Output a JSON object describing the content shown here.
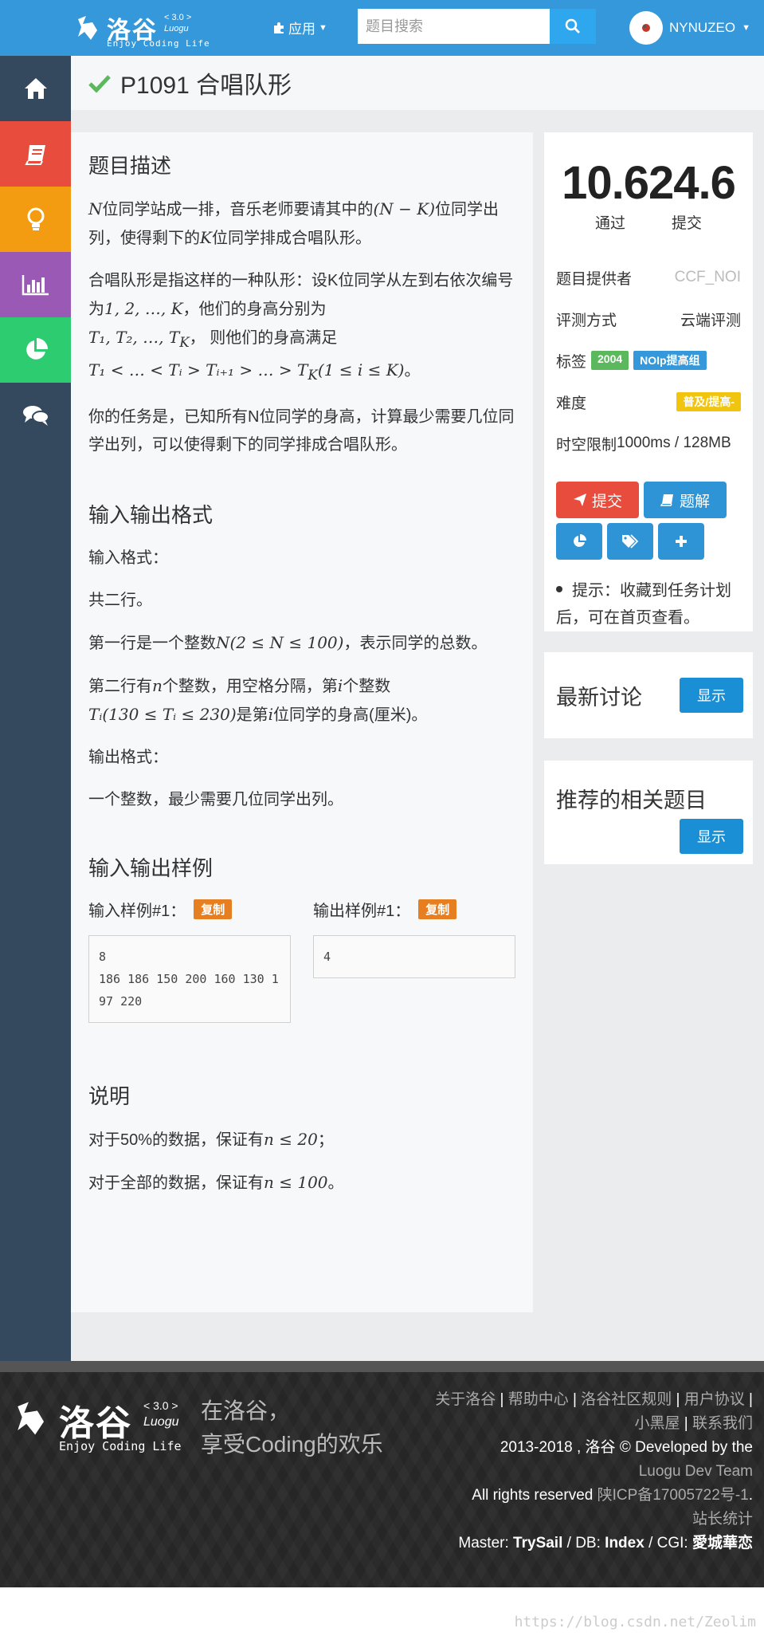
{
  "header": {
    "logo_version": "< 3.0 >",
    "logo_name": "洛谷",
    "logo_sub": "Luogu",
    "logo_tagline": "Enjoy Coding Life",
    "apps_label": "应用",
    "search_placeholder": "题目搜索",
    "username": "NYNUZEO"
  },
  "sidebar": {
    "items": [
      {
        "icon": "home-icon",
        "color": "#34495e"
      },
      {
        "icon": "book-icon",
        "color": "#e74c3c"
      },
      {
        "icon": "lightbulb-icon",
        "color": "#f39c12"
      },
      {
        "icon": "bar-chart-icon",
        "color": "#9b59b6"
      },
      {
        "icon": "pie-chart-icon",
        "color": "#2ecc71"
      },
      {
        "icon": "comments-icon",
        "color": "#34495e"
      }
    ]
  },
  "problem": {
    "title": "P1091 合唱队形",
    "description_heading": "题目描述",
    "desc_p1_a": "N",
    "desc_p1_b": "位同学站成一排，音乐老师要请其中的",
    "desc_p1_c": "(N − K)",
    "desc_p1_d": "位同学出列，使得剩下的",
    "desc_p1_e": "K",
    "desc_p1_f": "位同学排成合唱队形。",
    "desc_p2_a": "合唱队形是指这样的一种队形：设K位同学从左到右依次编号为",
    "desc_p2_b": "1, 2, …, K",
    "desc_p2_c": "，他们的身高分别为",
    "desc_p2_d": "T₁, T₂, …, T",
    "desc_p2_d2": "K",
    "desc_p2_e": "， 则他们的身高满足",
    "desc_p2_f": "T₁ < … < Tᵢ > Tᵢ₊₁ > … > T",
    "desc_p2_f2": "K",
    "desc_p2_g": "(1 ≤ i ≤ K)",
    "desc_p2_h": "。",
    "desc_p3": "你的任务是，已知所有N位同学的身高，计算最少需要几位同学出列，可以使得剩下的同学排成合唱队形。",
    "io_heading": "输入输出格式",
    "input_format_label": "输入格式：",
    "input_line1": "共二行。",
    "input_line2_a": "第一行是一个整数",
    "input_line2_b": "N(2 ≤ N ≤ 100)",
    "input_line2_c": "，表示同学的总数。",
    "input_line3_a": "第二行有",
    "input_line3_b": "n",
    "input_line3_c": "个整数，用空格分隔，第",
    "input_line3_d": "i",
    "input_line3_e": "个整数",
    "input_line3_f": "Tᵢ(130 ≤ Tᵢ ≤ 230)",
    "input_line3_g": "是第",
    "input_line3_h": "i",
    "input_line3_i": "位同学的身高(厘米)。",
    "output_format_label": "输出格式：",
    "output_line": "一个整数，最少需要几位同学出列。",
    "samples_heading": "输入输出样例",
    "sample_in_label": "输入样例#1：",
    "sample_out_label": "输出样例#1：",
    "copy_label": "复制",
    "sample_in": "8\n186 186 150 200 160 130 197 220",
    "sample_out": "4",
    "notes_heading": "说明",
    "note1_a": "对于50%的数据，保证有",
    "note1_b": "n ≤ 20",
    "note1_c": "；",
    "note2_a": "对于全部的数据，保证有",
    "note2_b": "n ≤ 100",
    "note2_c": "。"
  },
  "stats": {
    "count": "10.624.6",
    "pass_label": "通过",
    "submit_label": "提交",
    "provider_label": "题目提供者",
    "provider_value": "CCF_NOI",
    "judge_label": "评测方式",
    "judge_value": "云端评测",
    "tags_label": "标签",
    "tag1": "2004",
    "tag2": "NOIp提高组",
    "difficulty_label": "难度",
    "difficulty_value": "普及/提高-",
    "limit_label": "时空限制",
    "limit_value": "1000ms / 128MB",
    "submit_btn": "提交",
    "solution_btn": "题解",
    "tip": "提示：收藏到任务计划后，可在首页查看。"
  },
  "discuss": {
    "heading": "最新讨论",
    "show": "显示"
  },
  "recommend": {
    "heading": "推荐的相关题目",
    "show": "显示"
  },
  "footer": {
    "logo_version": "< 3.0 >",
    "logo_name": "洛谷",
    "logo_sub": "Luogu",
    "logo_tagline": "Enjoy Coding Life",
    "slogan1": "在洛谷，",
    "slogan2": "享受Coding的欢乐",
    "link_about": "关于洛谷",
    "link_help": "帮助中心",
    "link_rules": "洛谷社区规则",
    "link_user": "用户协议",
    "link_blackroom": "小黑屋",
    "link_contact": "联系我们",
    "copyright": "2013-2018 , 洛谷 © Developed by the",
    "team": "Luogu Dev Team",
    "rights": "All rights reserved",
    "icp": "陕ICP备17005722号-1",
    "period": ".",
    "stats": "站长统计",
    "master_label": "Master:",
    "master": "TrySail",
    "db_label": "/ DB:",
    "db": "Index",
    "cgi_label": "/ CGI:",
    "cgi": "愛城華恋"
  },
  "watermark": "https://blog.csdn.net/Zeolim"
}
